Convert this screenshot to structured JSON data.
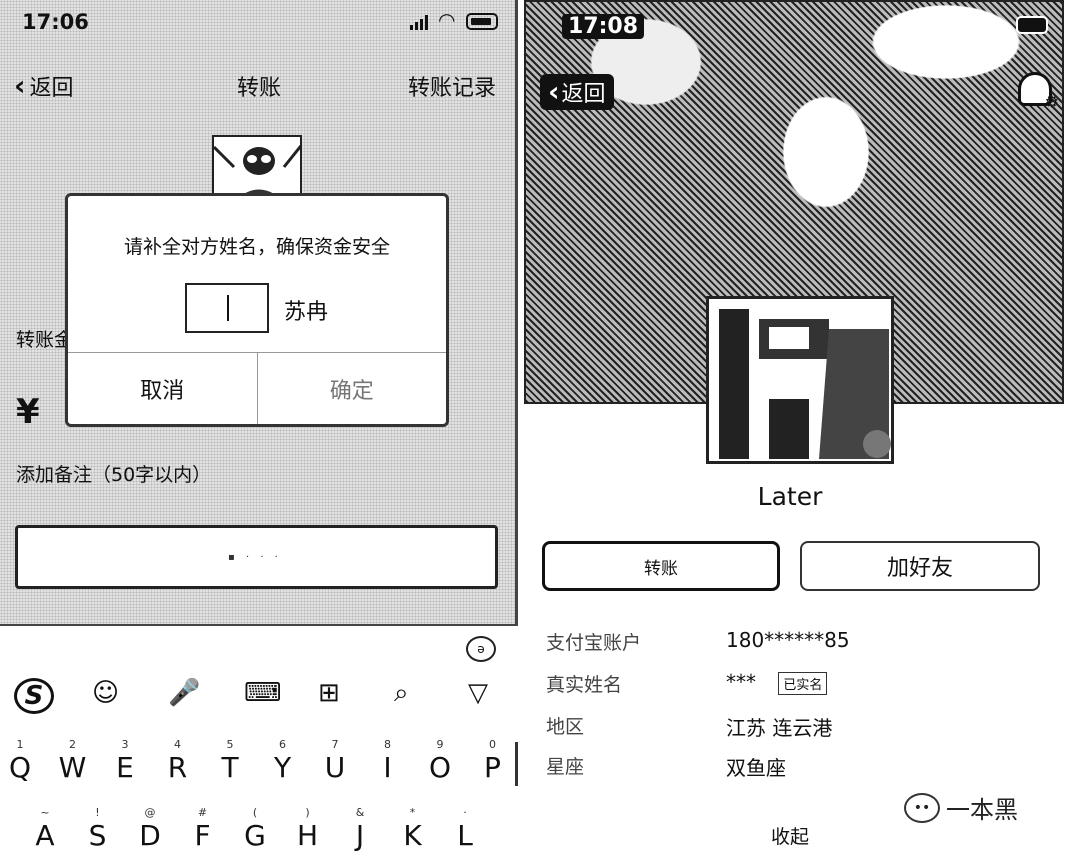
{
  "left_screen": {
    "status": {
      "time": "17:06"
    },
    "nav": {
      "back": "返回",
      "title": "转账",
      "record": "转账记录"
    },
    "amount_label": "转账金",
    "currency": "¥",
    "note": "添加备注（50字以内）",
    "dialog": {
      "message": "请补全对方姓名，确保资金安全",
      "name_input_value": "",
      "name_suffix": "苏冉",
      "cancel": "取消",
      "confirm": "确定"
    },
    "keyboard": {
      "toggle": "ə",
      "toolbar": {
        "logo": "S",
        "emoji": "☺",
        "mic": "🎤",
        "keyboard": "⌨",
        "grid": "⊞",
        "search": "⌕",
        "collapse": "▽"
      },
      "row1": [
        {
          "num": "1",
          "ch": "Q"
        },
        {
          "num": "2",
          "ch": "W"
        },
        {
          "num": "3",
          "ch": "E"
        },
        {
          "num": "4",
          "ch": "R"
        },
        {
          "num": "5",
          "ch": "T"
        },
        {
          "num": "6",
          "ch": "Y"
        },
        {
          "num": "7",
          "ch": "U"
        },
        {
          "num": "8",
          "ch": "I"
        },
        {
          "num": "9",
          "ch": "O"
        },
        {
          "num": "0",
          "ch": "P"
        }
      ],
      "row2": [
        {
          "num": "~",
          "ch": "A"
        },
        {
          "num": "!",
          "ch": "S"
        },
        {
          "num": "@",
          "ch": "D"
        },
        {
          "num": "#",
          "ch": "F"
        },
        {
          "num": "(",
          "ch": "G"
        },
        {
          "num": ")",
          "ch": "H"
        },
        {
          "num": "&",
          "ch": "J"
        },
        {
          "num": "*",
          "ch": "K"
        },
        {
          "num": "·",
          "ch": "L"
        }
      ]
    }
  },
  "right_screen": {
    "status": {
      "time": "17:08"
    },
    "nav": {
      "back": "返回"
    },
    "nickname": "Later",
    "buttons": {
      "transfer": "转账",
      "add_friend": "加好友"
    },
    "info": [
      {
        "label": "支付宝账户",
        "value": "180******85",
        "badge": ""
      },
      {
        "label": "真实姓名",
        "value": "***",
        "badge": "已实名"
      },
      {
        "label": "地区",
        "value": "江苏 连云港",
        "badge": ""
      },
      {
        "label": "星座",
        "value": "双鱼座",
        "badge": ""
      }
    ],
    "collapse": "收起",
    "watermark": "一本黑"
  }
}
